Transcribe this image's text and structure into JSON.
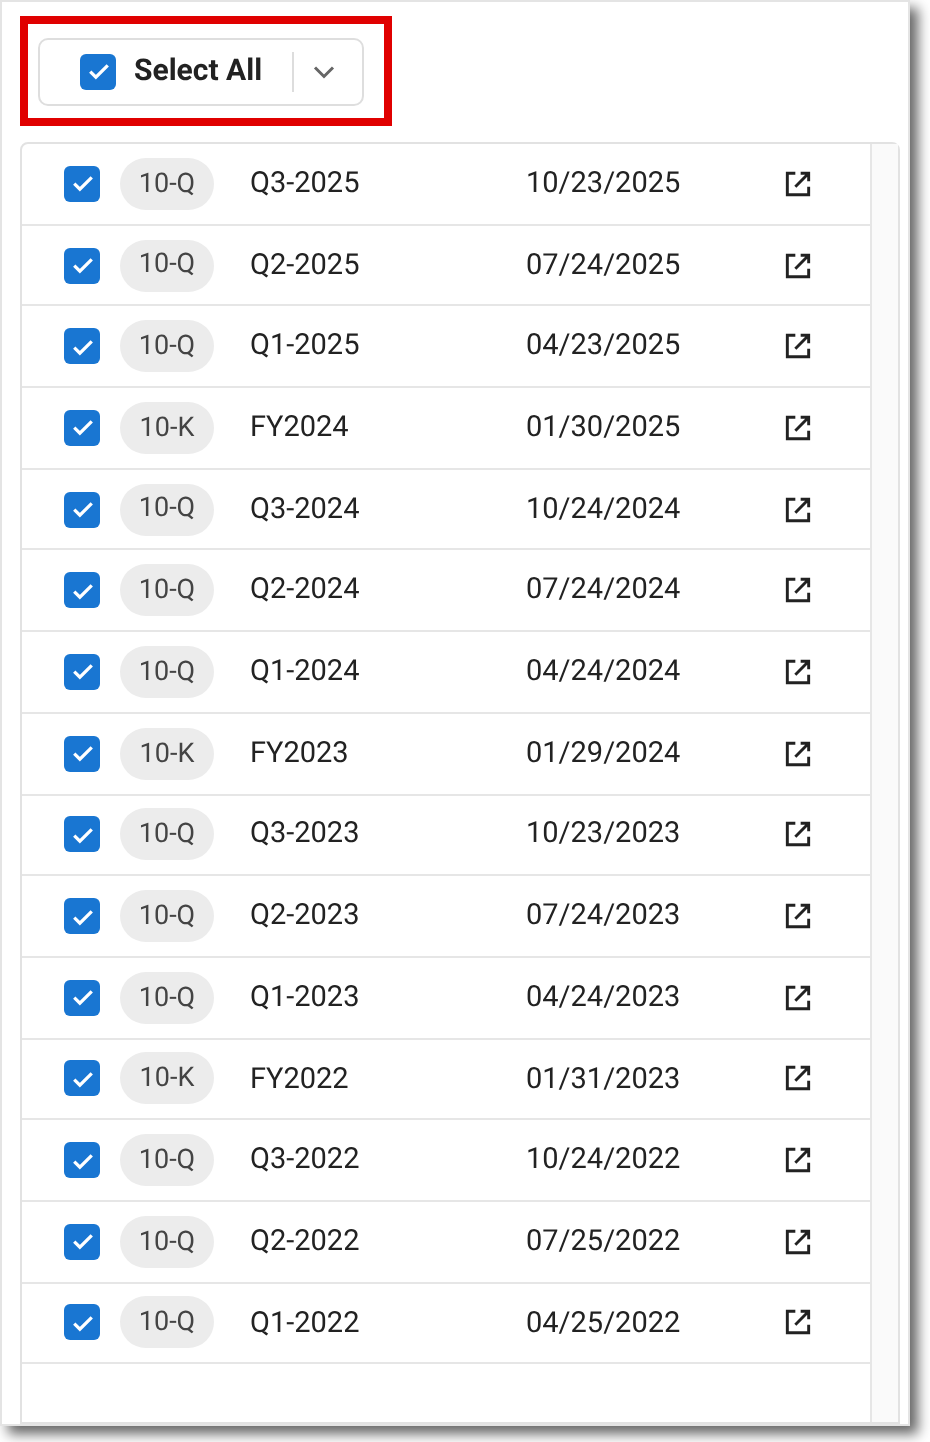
{
  "select_all": {
    "label": "Select All",
    "checked": true
  },
  "rows": [
    {
      "checked": true,
      "form": "10-Q",
      "period": "Q3-2025",
      "date": "10/23/2025"
    },
    {
      "checked": true,
      "form": "10-Q",
      "period": "Q2-2025",
      "date": "07/24/2025"
    },
    {
      "checked": true,
      "form": "10-Q",
      "period": "Q1-2025",
      "date": "04/23/2025"
    },
    {
      "checked": true,
      "form": "10-K",
      "period": "FY2024",
      "date": "01/30/2025"
    },
    {
      "checked": true,
      "form": "10-Q",
      "period": "Q3-2024",
      "date": "10/24/2024"
    },
    {
      "checked": true,
      "form": "10-Q",
      "period": "Q2-2024",
      "date": "07/24/2024"
    },
    {
      "checked": true,
      "form": "10-Q",
      "period": "Q1-2024",
      "date": "04/24/2024"
    },
    {
      "checked": true,
      "form": "10-K",
      "period": "FY2023",
      "date": "01/29/2024"
    },
    {
      "checked": true,
      "form": "10-Q",
      "period": "Q3-2023",
      "date": "10/23/2023"
    },
    {
      "checked": true,
      "form": "10-Q",
      "period": "Q2-2023",
      "date": "07/24/2023"
    },
    {
      "checked": true,
      "form": "10-Q",
      "period": "Q1-2023",
      "date": "04/24/2023"
    },
    {
      "checked": true,
      "form": "10-K",
      "period": "FY2022",
      "date": "01/31/2023"
    },
    {
      "checked": true,
      "form": "10-Q",
      "period": "Q3-2022",
      "date": "10/24/2022"
    },
    {
      "checked": true,
      "form": "10-Q",
      "period": "Q2-2022",
      "date": "07/25/2022"
    },
    {
      "checked": true,
      "form": "10-Q",
      "period": "Q1-2022",
      "date": "04/25/2022"
    }
  ]
}
